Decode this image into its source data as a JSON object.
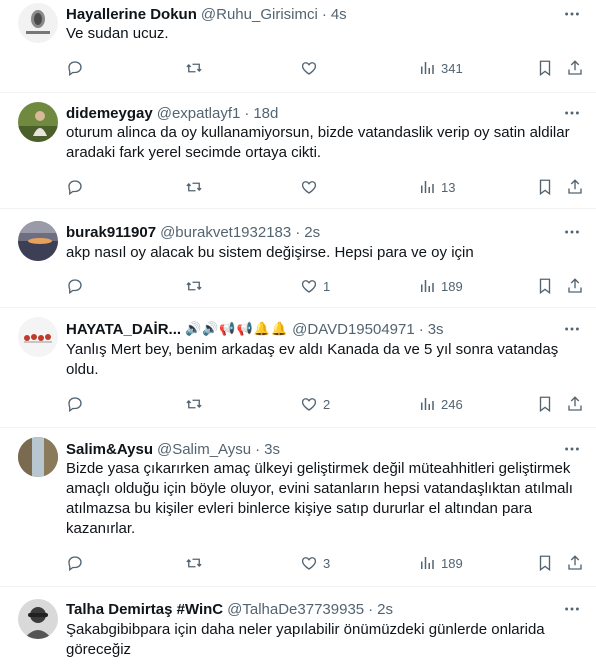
{
  "tweets": [
    {
      "name": "Hayallerine Dokun",
      "handle": "@Ruhu_Girisimci",
      "time": "4s",
      "emoji": "",
      "text": "Ve sudan ucuz.",
      "reply_count": "",
      "like_count": "",
      "views": "341"
    },
    {
      "name": "didemeygay",
      "handle": "@expatlayf1",
      "time": "18d",
      "emoji": "",
      "text": "oturum alinca da oy kullanamiyorsun, bizde vatandaslik verip oy satin aldilar aradaki fark yerel secimde ortaya cikti.",
      "reply_count": "",
      "like_count": "",
      "views": "13"
    },
    {
      "name": "burak911907",
      "handle": "@burakvet1932183",
      "time": "2s",
      "emoji": "",
      "text": "akp nasıl oy alacak bu sistem değişirse. Hepsi para ve oy için",
      "reply_count": "",
      "like_count": "1",
      "views": "189"
    },
    {
      "name": "HAYATA_DAİR...",
      "handle": "@DAVD19504971",
      "time": "3s",
      "emoji": "🔊🔊📢📢🔔🔔",
      "text": "Yanlış Mert bey, benim arkadaş ev aldı Kanada da ve 5 yıl sonra vatandaş oldu.",
      "reply_count": "",
      "like_count": "2",
      "views": "246"
    },
    {
      "name": "Salim&Aysu",
      "handle": "@Salim_Aysu",
      "time": "3s",
      "emoji": "",
      "text": "Bizde yasa çıkarırken amaç ülkeyi geliştirmek değil müteahhitleri geliştirmek amaçlı olduğu için böyle oluyor, evini satanların hepsi vatandaşlıktan atılmalı atılmazsa bu kişiler evleri binlerce kişiye satıp dururlar el altından para kazanırlar.",
      "reply_count": "",
      "like_count": "3",
      "views": "189"
    },
    {
      "name": "Talha Demirtaş #WinC",
      "handle": "@TalhaDe37739935",
      "time": "2s",
      "emoji": "",
      "text": "Şakabgibibpara için daha neler yapılabilir önümüzdeki günlerde onlarida göreceğiz",
      "reply_count": "",
      "like_count": "",
      "views": ""
    }
  ],
  "icons": {
    "more": "more-icon",
    "reply": "reply-icon",
    "retweet": "retweet-icon",
    "like": "like-icon",
    "views": "views-icon",
    "bookmark": "bookmark-icon",
    "share": "share-icon"
  },
  "colors": {
    "text": "#0f1419",
    "secondary": "#536471",
    "divider": "#eff3f4"
  }
}
